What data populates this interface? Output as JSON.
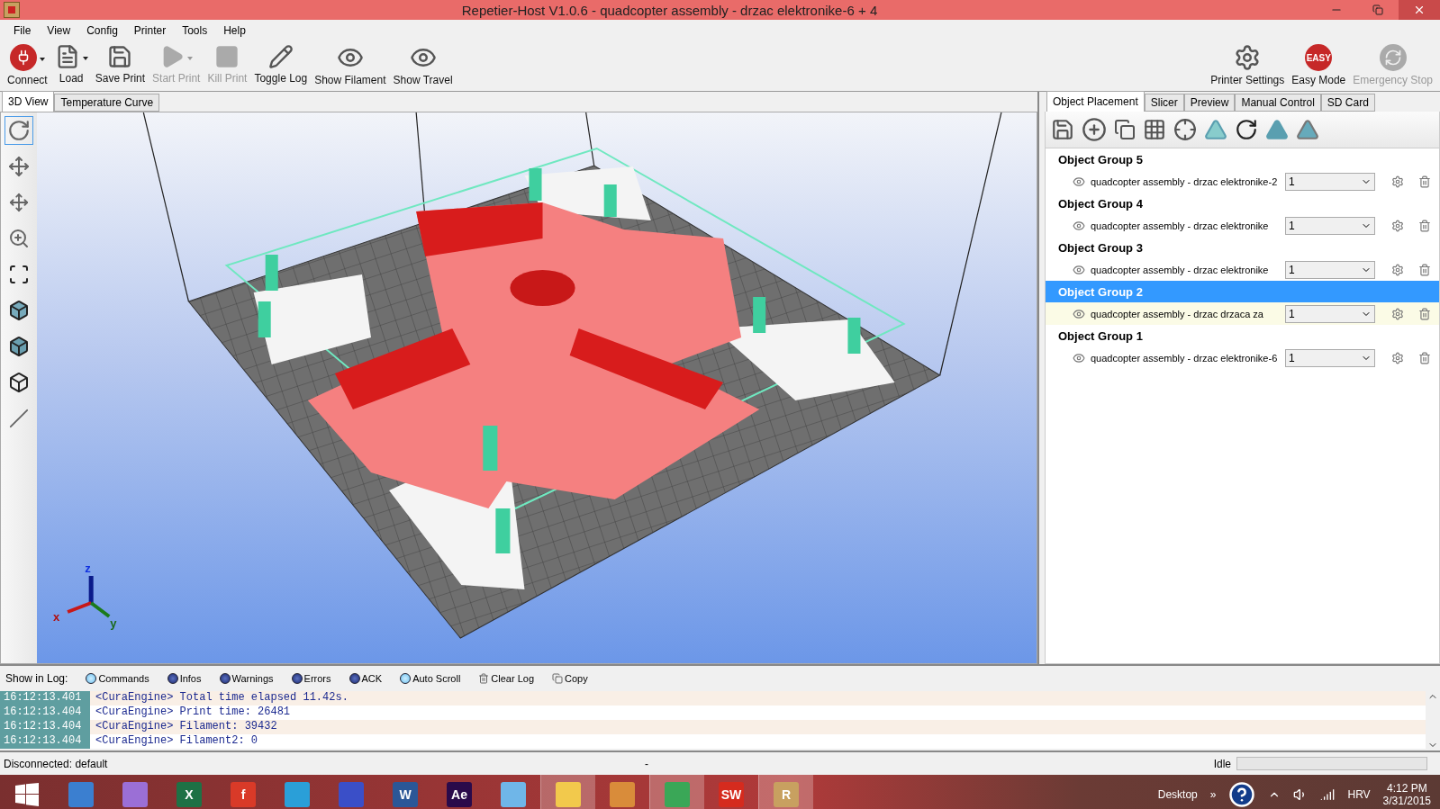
{
  "window": {
    "title": "Repetier-Host V1.0.6 - quadcopter assembly - drzac elektronike-6 + 4"
  },
  "menu": [
    "File",
    "View",
    "Config",
    "Printer",
    "Tools",
    "Help"
  ],
  "toolbar": [
    {
      "kind": "connect",
      "label": "Connect",
      "disabled": false,
      "dropdown": true
    },
    {
      "kind": "load",
      "label": "Load",
      "disabled": false,
      "dropdown": true
    },
    {
      "kind": "save",
      "label": "Save Print",
      "disabled": false,
      "dropdown": false
    },
    {
      "kind": "start",
      "label": "Start Print",
      "disabled": true,
      "dropdown": true
    },
    {
      "kind": "kill",
      "label": "Kill Print",
      "disabled": true,
      "dropdown": false
    },
    {
      "kind": "log",
      "label": "Toggle Log",
      "disabled": false,
      "dropdown": false
    },
    {
      "kind": "eye",
      "label": "Show Filament",
      "disabled": false,
      "dropdown": false
    },
    {
      "kind": "eye",
      "label": "Show Travel",
      "disabled": false,
      "dropdown": false
    }
  ],
  "toolbar_right": [
    {
      "kind": "settings",
      "label": "Printer Settings",
      "disabled": false
    },
    {
      "kind": "easy",
      "label": "Easy Mode",
      "badge": "EASY",
      "disabled": false
    },
    {
      "kind": "stop",
      "label": "Emergency Stop",
      "disabled": true
    }
  ],
  "view_tabs": [
    {
      "label": "3D View",
      "selected": true
    },
    {
      "label": "Temperature Curve",
      "selected": false
    }
  ],
  "axes": {
    "z": "z",
    "x": "x",
    "y": "y"
  },
  "panel_tabs": [
    {
      "label": "Object Placement",
      "selected": true
    },
    {
      "label": "Slicer",
      "selected": false
    },
    {
      "label": "Preview",
      "selected": false
    },
    {
      "label": "Manual Control",
      "selected": false
    },
    {
      "label": "SD Card",
      "selected": false
    }
  ],
  "object_groups": [
    {
      "title": "Object Group 5",
      "selected": false,
      "objects": [
        {
          "name": "quadcopter assembly - drzac elektronike-2",
          "copies": "1"
        }
      ]
    },
    {
      "title": "Object Group 4",
      "selected": false,
      "objects": [
        {
          "name": "quadcopter assembly - drzac elektronike",
          "copies": "1"
        }
      ]
    },
    {
      "title": "Object Group 3",
      "selected": false,
      "objects": [
        {
          "name": "quadcopter assembly - drzac elektronike",
          "copies": "1"
        }
      ]
    },
    {
      "title": "Object Group 2",
      "selected": true,
      "objects": [
        {
          "name": "quadcopter assembly - drzac drzaca za",
          "copies": "1"
        }
      ]
    },
    {
      "title": "Object Group 1",
      "selected": false,
      "objects": [
        {
          "name": "quadcopter assembly - drzac elektronike-6",
          "copies": "1"
        }
      ]
    }
  ],
  "log_bar": {
    "label": "Show in Log:",
    "filters": [
      {
        "label": "Commands",
        "on": true
      },
      {
        "label": "Infos",
        "on": false
      },
      {
        "label": "Warnings",
        "on": false
      },
      {
        "label": "Errors",
        "on": false
      },
      {
        "label": "ACK",
        "on": false
      },
      {
        "label": "Auto Scroll",
        "on": true
      }
    ],
    "actions": [
      {
        "kind": "clear",
        "label": "Clear Log"
      },
      {
        "kind": "copy",
        "label": "Copy"
      }
    ]
  },
  "log": [
    {
      "time": "16:12:13.401",
      "message": "<CuraEngine> Total time elapsed 11.42s."
    },
    {
      "time": "16:12:13.404",
      "message": "<CuraEngine> Print time: 26481"
    },
    {
      "time": "16:12:13.404",
      "message": "<CuraEngine> Filament: 39432"
    },
    {
      "time": "16:12:13.404",
      "message": "<CuraEngine> Filament2: 0"
    }
  ],
  "status_bar": {
    "connection": "Disconnected: default",
    "middle": "-",
    "state": "Idle",
    "level": 0
  },
  "taskbar": {
    "apps": [
      {
        "color": "#3b7fd0",
        "open": false
      },
      {
        "color": "#9b6fd6",
        "open": false
      },
      {
        "label": "X",
        "color": "#1e7145",
        "open": false
      },
      {
        "label": "f",
        "color": "#d93a28",
        "open": false
      },
      {
        "color": "#2a9fd8",
        "open": false
      },
      {
        "color": "#3a4fc8",
        "open": false
      },
      {
        "label": "W",
        "color": "#2b5797",
        "open": false
      },
      {
        "label": "Ae",
        "color": "#2a0a4a",
        "open": false
      },
      {
        "color": "#6fb6e8",
        "open": false
      },
      {
        "color": "#f2c94c",
        "open": true
      },
      {
        "color": "#d98c3a",
        "open": false
      },
      {
        "color": "#3aa757",
        "open": true
      },
      {
        "label": "SW",
        "color": "#d52b1e",
        "open": false
      },
      {
        "label": "R",
        "color": "#c8a060",
        "open": true
      }
    ],
    "desktop": "Desktop",
    "chevron": "»",
    "language": "HRV",
    "time": "4:12 PM",
    "date": "3/31/2015"
  }
}
